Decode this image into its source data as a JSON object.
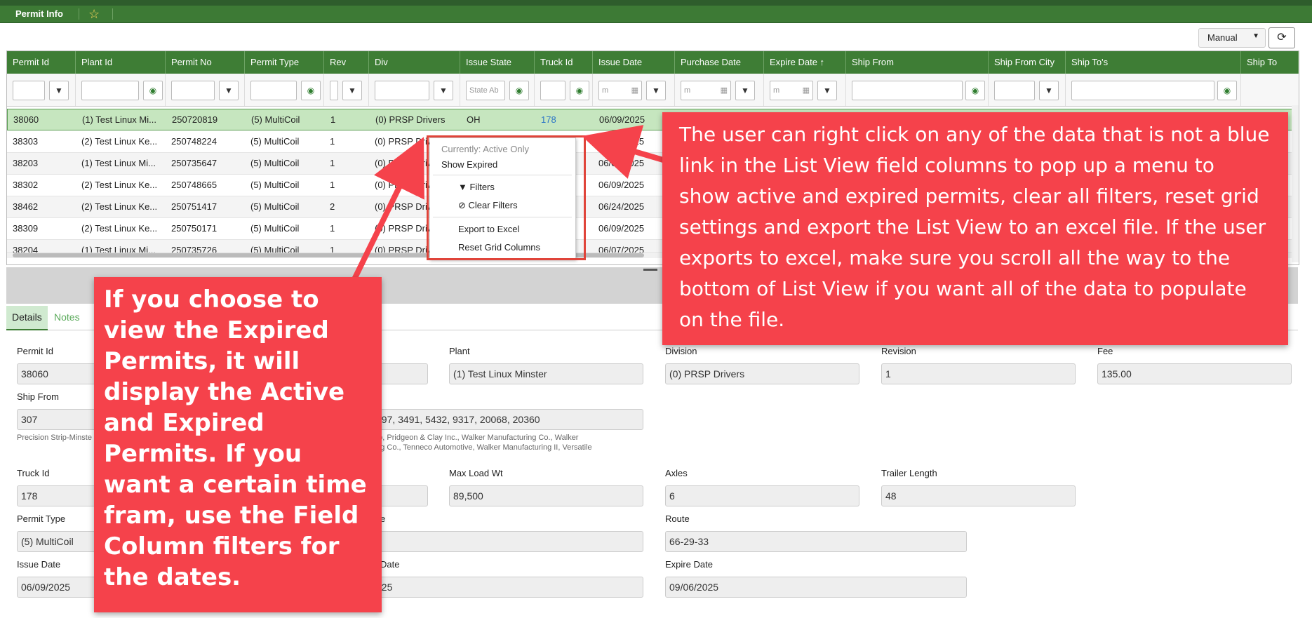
{
  "app": {
    "tab_title": "Permit Info",
    "star_icon": "star-icon"
  },
  "toolbar": {
    "mode_value": "Manual",
    "refresh_icon": "refresh-icon"
  },
  "grid": {
    "columns": [
      "Permit Id",
      "Plant Id",
      "Permit No",
      "Permit Type",
      "Rev",
      "Div",
      "Issue State",
      "Truck Id",
      "Issue Date",
      "Purchase Date",
      "Expire Date ↑",
      "Ship From",
      "Ship From City",
      "Ship To's",
      "Ship To"
    ],
    "filters": {
      "issue_state_placeholder": "State Ab",
      "date_placeholder": "m"
    },
    "rows": [
      [
        "38060",
        "(1) Test Linux Mi...",
        "250720819",
        "(5) MultiCoil",
        "1",
        "(0) PRSP Drivers",
        "OH",
        "178",
        "06/09/2025"
      ],
      [
        "38303",
        "(2) Test Linux Ke...",
        "250748224",
        "(5) MultiCoil",
        "1",
        "(0) PRSP Driv",
        "",
        "",
        "06/09/2025"
      ],
      [
        "38203",
        "(1) Test Linux Mi...",
        "250735647",
        "(5) MultiCoil",
        "1",
        "(0) PRSP Driv",
        "",
        "",
        "06/09/2025"
      ],
      [
        "38302",
        "(2) Test Linux Ke...",
        "250748665",
        "(5) MultiCoil",
        "1",
        "(0) PRSP Driv",
        "",
        "",
        "06/09/2025"
      ],
      [
        "38462",
        "(2) Test Linux Ke...",
        "250751417",
        "(5) MultiCoil",
        "2",
        "(0) PRSP Driv",
        "",
        "",
        "06/24/2025"
      ],
      [
        "38309",
        "(2) Test Linux Ke...",
        "250750171",
        "(5) MultiCoil",
        "1",
        "(0) PRSP Driv",
        "",
        "",
        "06/09/2025"
      ],
      [
        "38204",
        "(1) Test Linux Mi...",
        "250735726",
        "(5) MultiCoil",
        "1",
        "(0) PRSP Driv",
        "",
        "",
        "06/07/2025"
      ]
    ]
  },
  "context_menu": {
    "status": "Currently: Active Only",
    "show_expired": "Show Expired",
    "filters": "Filters",
    "clear_filters": "Clear Filters",
    "export": "Export to Excel",
    "reset": "Reset Grid Columns"
  },
  "details": {
    "tabs": [
      "Details",
      "Notes"
    ],
    "permit_id_label": "Permit Id",
    "permit_id": "38060",
    "plant_label": "Plant",
    "plant": "(1) Test Linux Minster",
    "division_label": "Division",
    "division": "(0) PRSP Drivers",
    "revision_label": "Revision",
    "revision": "1",
    "fee_label": "Fee",
    "fee": "135.00",
    "ship_from_label": "Ship From",
    "ship_from": "307",
    "ship_from_sub": "Precision Strip-Minste",
    "ship_to_values": "097, 3491, 5432, 9317, 20068, 20360",
    "ship_to_names_1": "ato, Pridgeon & Clay Inc., Walker Manufacturing Co., Walker",
    "ship_to_names_2": "ring Co., Tenneco Automotive, Walker Manufacturing II, Versatile",
    "truck_id_label": "Truck Id",
    "truck_id": "178",
    "max_load_label": "Max Load Wt",
    "max_load": "89,500",
    "axles_label": "Axles",
    "axles": "6",
    "trailer_length_label": "Trailer Length",
    "trailer_length": "48",
    "permit_type_label": "Permit Type",
    "permit_type": "(5) MultiCoil",
    "route_label_partial": "e",
    "route_label": "Route",
    "route": "66-29-33",
    "issue_date_label": "Issue Date",
    "issue_date": "06/09/2025",
    "purchase_date_label_partial": "Date",
    "purchase_date_partial": "025",
    "expire_date_label": "Expire Date",
    "expire_date": "09/06/2025"
  },
  "callouts": {
    "right": "The user can right click on any of the data that is not a blue link in the List View field columns to pop up a menu to show active and expired permits, clear all filters, reset grid settings and export the List View to an excel file. If the user exports to excel, make sure you scroll all the way to the bottom of List View if you want all of the data to populate on the file.",
    "left": "If you choose to view the Expired Permits, it will display the Active and Expired Permits. If you want a certain time fram, use the Field Column filters for the dates."
  },
  "colors": {
    "header_green": "#3e7d35",
    "callout_red": "#f5424b",
    "selected_row": "#c6e6bf",
    "link_blue": "#2b74c7"
  }
}
